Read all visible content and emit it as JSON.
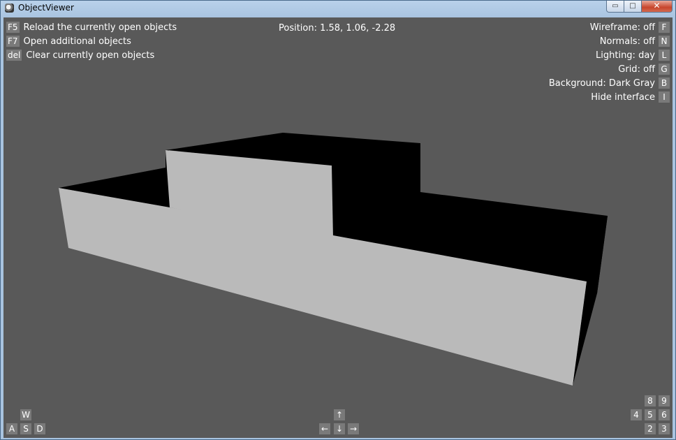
{
  "window": {
    "title": "ObjectViewer",
    "minimize_glyph": "▭",
    "maximize_glyph": "□",
    "close_glyph": "✕"
  },
  "hud": {
    "position": "Position: 1.58, 1.06, -2.28",
    "left_commands": [
      {
        "key": "F5",
        "label": "Reload the currently open objects"
      },
      {
        "key": "F7",
        "label": "Open additional objects"
      },
      {
        "key": "del",
        "label": "Clear currently open objects"
      }
    ],
    "right_toggles": [
      {
        "label": "Wireframe: off",
        "key": "F"
      },
      {
        "label": "Normals: off",
        "key": "N"
      },
      {
        "label": "Lighting: day",
        "key": "L"
      },
      {
        "label": "Grid: off",
        "key": "G"
      },
      {
        "label": "Background: Dark Gray",
        "key": "B"
      },
      {
        "label": "Hide interface",
        "key": "I"
      }
    ],
    "wasd": {
      "w": "W",
      "a": "A",
      "s": "S",
      "d": "D"
    },
    "arrows": {
      "up": "↑",
      "left": "←",
      "down": "↓",
      "right": "→"
    },
    "numpad": {
      "k8": "8",
      "k9": "9",
      "k4": "4",
      "k5": "5",
      "k6": "6",
      "k2": "2",
      "k3": "3"
    }
  },
  "colors": {
    "background": "#595959",
    "light_face": "#bababa",
    "dark_face": "#000000",
    "key_bg": "#7a7a7a"
  }
}
